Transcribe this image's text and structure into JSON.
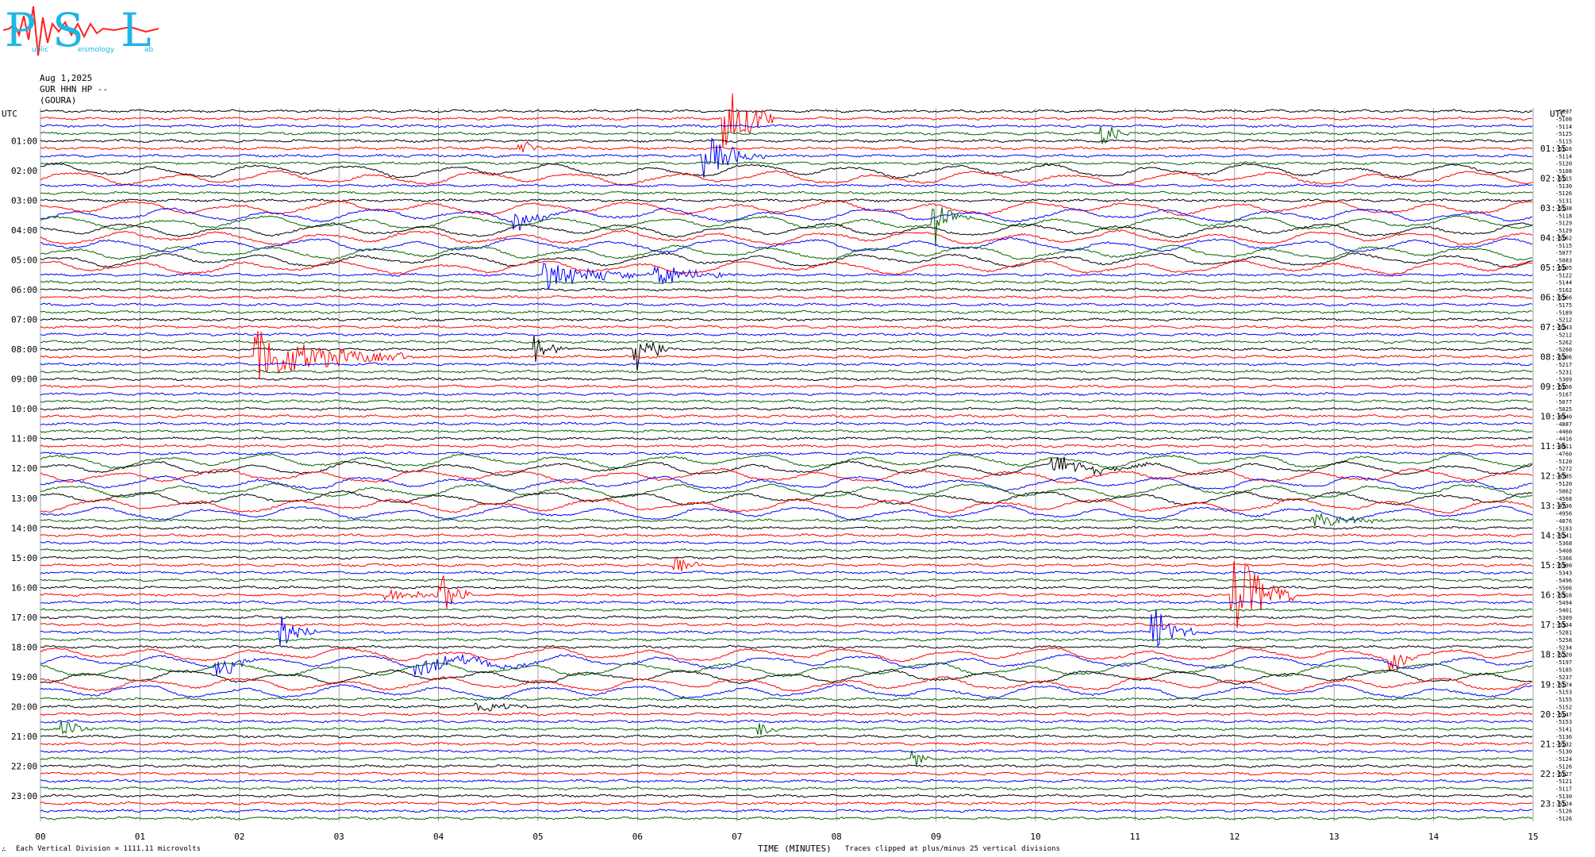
{
  "logo": {
    "letters": [
      "P",
      "S",
      "L"
    ],
    "small_words": [
      "ublic",
      "eismology",
      "ab"
    ]
  },
  "header": {
    "date": "Aug 1,2025",
    "station": "GUR HHN HP --",
    "location": "(GOURA)"
  },
  "axis": {
    "utc_left": "UTC",
    "utc_right": "UTC",
    "xlabel": "TIME (MINUTES)",
    "scale_note": "Each Vertical Division = 1111.11 microvolts",
    "clip_note": "Traces clipped at plus/minus 25 vertical divisions",
    "corner_mark": "∴"
  },
  "colors": {
    "trace_cycle": [
      "#000000",
      "#ff0000",
      "#0000ff",
      "#006400"
    ],
    "logo": "#1fb6e6",
    "logo_wave": "#ff2020",
    "grid": "#8a8a8a"
  },
  "chart_data": {
    "type": "line",
    "xlim": [
      0,
      15
    ],
    "x_ticks": [
      "00",
      "01",
      "02",
      "03",
      "04",
      "05",
      "06",
      "07",
      "08",
      "09",
      "10",
      "11",
      "12",
      "13",
      "14",
      "15"
    ],
    "rows": 96,
    "minutes_per_row": 15,
    "left_hour_labels": [
      "01:00",
      "02:00",
      "03:00",
      "04:00",
      "05:00",
      "06:00",
      "07:00",
      "08:00",
      "09:00",
      "10:00",
      "11:00",
      "12:00",
      "13:00",
      "14:00",
      "15:00",
      "16:00",
      "17:00",
      "18:00",
      "19:00",
      "20:00",
      "21:00",
      "22:00",
      "23:00"
    ],
    "right_hour_labels": [
      "01:15",
      "02:15",
      "03:15",
      "04:15",
      "05:15",
      "06:15",
      "07:15",
      "08:15",
      "09:15",
      "10:15",
      "11:15",
      "12:15",
      "13:15",
      "14:15",
      "15:15",
      "16:15",
      "17:15",
      "18:15",
      "19:15",
      "20:15",
      "21:15",
      "22:15",
      "23:15"
    ],
    "row_offsets": [
      "-5097",
      "-5108",
      "-5114",
      "-5125",
      "-5115",
      "-5116",
      "-5114",
      "-5120",
      "-5108",
      "-5115",
      "-5130",
      "-5126",
      "-5131",
      "-5138",
      "-5118",
      "-5129",
      "-5129",
      "-5162",
      "-5115",
      "-5077",
      "-5083",
      "-5105",
      "-5122",
      "-5144",
      "-5162",
      "-5166",
      "-5175",
      "-5189",
      "-5212",
      "-5243",
      "-5212",
      "-5262",
      "-5260",
      "-5206",
      "-5217",
      "-5231",
      "-5309",
      "-5156",
      "-5167",
      "-5077",
      "-5025",
      "-4940",
      "-4887",
      "-4460",
      "-4416",
      "-4611",
      "-4760",
      "-5120",
      "-5272",
      "-4785",
      "-5120",
      "-5062",
      "-4568",
      "-4736",
      "-4956",
      "-4876",
      "-5183",
      "-5241",
      "-5368",
      "-5408",
      "-5366",
      "-5390",
      "-5343",
      "-5496",
      "-5506",
      "-5516",
      "-5494",
      "-5401",
      "-5309",
      "-5334",
      "-5281",
      "-5258",
      "-5234",
      "-5220",
      "-5197",
      "-5185",
      "-5237",
      "-5174",
      "-5153",
      "-5155",
      "-5152",
      "-5147",
      "-5153",
      "-5141",
      "-5136",
      "-5132",
      "-5130",
      "-5124",
      "-5126",
      "-5127",
      "-5121",
      "-5117",
      "-5130",
      "-5124",
      "-5126",
      "-5126"
    ],
    "events": [
      {
        "row": 1,
        "minute": 6.9,
        "amp": 5.5,
        "dur": 0.5
      },
      {
        "row": 3,
        "minute": 10.7,
        "amp": 1.6,
        "dur": 0.3
      },
      {
        "row": 5,
        "minute": 4.85,
        "amp": 1.3,
        "dur": 0.25
      },
      {
        "row": 6,
        "minute": 6.7,
        "amp": 3.0,
        "dur": 0.6
      },
      {
        "row": 14,
        "minute": 4.8,
        "amp": 1.5,
        "dur": 0.4
      },
      {
        "row": 15,
        "minute": 9.0,
        "amp": 3.0,
        "dur": 0.35
      },
      {
        "row": 22,
        "minute": 5.1,
        "amp": 2.0,
        "dur": 1.2
      },
      {
        "row": 22,
        "minute": 6.2,
        "amp": 1.5,
        "dur": 0.8
      },
      {
        "row": 33,
        "minute": 2.2,
        "amp": 3.5,
        "dur": 1.5
      },
      {
        "row": 32,
        "minute": 5.0,
        "amp": 2.0,
        "dur": 0.3
      },
      {
        "row": 32,
        "minute": 6.0,
        "amp": 4.0,
        "dur": 0.3
      },
      {
        "row": 48,
        "minute": 10.2,
        "amp": 1.2,
        "dur": 1.0
      },
      {
        "row": 55,
        "minute": 12.8,
        "amp": 1.0,
        "dur": 0.9
      },
      {
        "row": 61,
        "minute": 6.4,
        "amp": 1.2,
        "dur": 0.3
      },
      {
        "row": 65,
        "minute": 12.0,
        "amp": 6.5,
        "dur": 0.6
      },
      {
        "row": 65,
        "minute": 4.05,
        "amp": 2.8,
        "dur": 0.3
      },
      {
        "row": 65,
        "minute": 3.5,
        "amp": 1.0,
        "dur": 0.8
      },
      {
        "row": 70,
        "minute": 2.45,
        "amp": 2.2,
        "dur": 0.35
      },
      {
        "row": 70,
        "minute": 11.2,
        "amp": 3.5,
        "dur": 0.4
      },
      {
        "row": 73,
        "minute": 13.6,
        "amp": 1.5,
        "dur": 0.3
      },
      {
        "row": 74,
        "minute": 1.8,
        "amp": 1.2,
        "dur": 0.5
      },
      {
        "row": 74,
        "minute": 3.8,
        "amp": 1.4,
        "dur": 1.2
      },
      {
        "row": 80,
        "minute": 4.4,
        "amp": 1.0,
        "dur": 0.5
      },
      {
        "row": 83,
        "minute": 0.25,
        "amp": 1.2,
        "dur": 0.3
      },
      {
        "row": 83,
        "minute": 7.25,
        "amp": 1.0,
        "dur": 0.3
      },
      {
        "row": 87,
        "minute": 8.8,
        "amp": 1.1,
        "dur": 0.2
      }
    ],
    "long_period_rows": [
      [
        47,
        54
      ],
      [
        73,
        78
      ],
      [
        13,
        21
      ],
      [
        8,
        9
      ]
    ]
  }
}
